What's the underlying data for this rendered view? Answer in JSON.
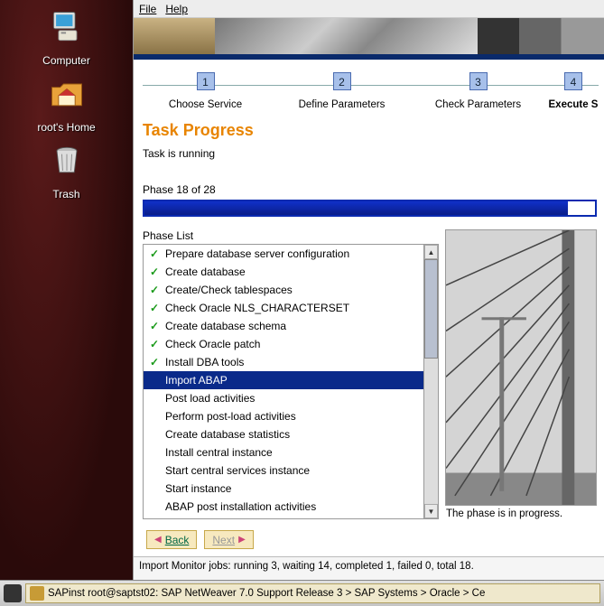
{
  "desktop": {
    "icons": [
      {
        "name": "computer-icon",
        "label": "Computer"
      },
      {
        "name": "home-icon",
        "label": "root's Home"
      },
      {
        "name": "trash-icon",
        "label": "Trash"
      }
    ]
  },
  "menu": {
    "file": "File",
    "help": "Help"
  },
  "steps": [
    {
      "num": "1",
      "label": "Choose Service"
    },
    {
      "num": "2",
      "label": "Define Parameters"
    },
    {
      "num": "3",
      "label": "Check Parameters"
    },
    {
      "num": "4",
      "label": "Execute S"
    }
  ],
  "title": "Task Progress",
  "subtitle": "Task is running",
  "phase_label": "Phase 18 of 28",
  "phase_list_label": "Phase List",
  "phases": [
    {
      "done": true,
      "label": "Prepare database server configuration"
    },
    {
      "done": true,
      "label": "Create database"
    },
    {
      "done": true,
      "label": "Create/Check tablespaces"
    },
    {
      "done": true,
      "label": "Check Oracle NLS_CHARACTERSET"
    },
    {
      "done": true,
      "label": "Create database schema"
    },
    {
      "done": true,
      "label": "Check Oracle patch"
    },
    {
      "done": true,
      "label": "Install DBA tools"
    },
    {
      "done": false,
      "label": "Import ABAP",
      "selected": true
    },
    {
      "done": false,
      "label": "Post load activities"
    },
    {
      "done": false,
      "label": "Perform post-load activities"
    },
    {
      "done": false,
      "label": "Create database statistics"
    },
    {
      "done": false,
      "label": "Install central instance"
    },
    {
      "done": false,
      "label": "Start central services instance"
    },
    {
      "done": false,
      "label": "Start instance"
    },
    {
      "done": false,
      "label": "ABAP post installation activities"
    }
  ],
  "caption": "The phase is in progress.",
  "nav": {
    "back": "Back",
    "next": "Next"
  },
  "status": "Import Monitor jobs: running 3, waiting 14, completed 1, failed 0, total 18.",
  "taskbar": "SAPinst root@saptst02: SAP NetWeaver 7.0 Support Release 3 > SAP Systems > Oracle > Ce"
}
